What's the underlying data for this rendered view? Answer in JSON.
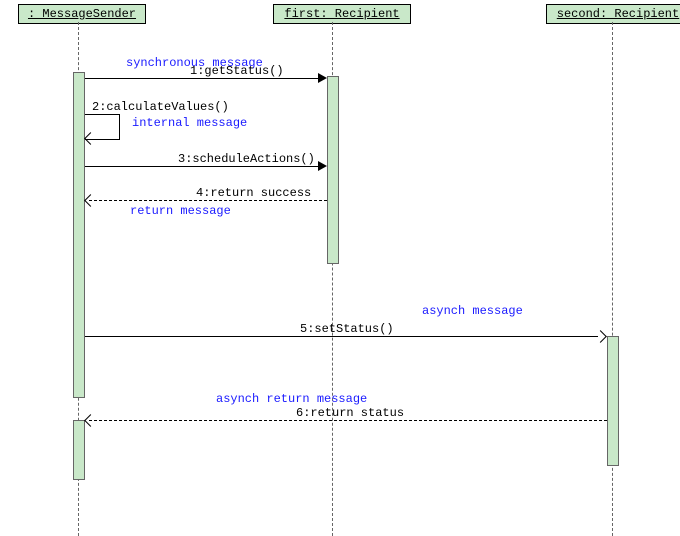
{
  "participants": {
    "p1": ": MessageSender",
    "p2": "first: Recipient",
    "p3": "second: Recipient"
  },
  "messages": {
    "m1": "1:getStatus()",
    "m2": "2:calculateValues()",
    "m3": "3:scheduleActions()",
    "m4": "4:return success",
    "m5": "5:setStatus()",
    "m6": "6:return status"
  },
  "annotations": {
    "sync": "synchronous message",
    "internal": "internal message",
    "ret": "return message",
    "asynch": "asynch message",
    "asynch_ret": "asynch return message"
  },
  "colors": {
    "participant_bg": "#c9e8c9",
    "annotation": "#1a1aff"
  },
  "chart_data": {
    "type": "sequence-diagram",
    "participants": [
      {
        "id": "sender",
        "label": ": MessageSender"
      },
      {
        "id": "first",
        "label": "first: Recipient"
      },
      {
        "id": "second",
        "label": "second: Recipient"
      }
    ],
    "messages": [
      {
        "seq": 1,
        "from": "sender",
        "to": "first",
        "label": "getStatus()",
        "kind": "sync",
        "note": "synchronous message"
      },
      {
        "seq": 2,
        "from": "sender",
        "to": "sender",
        "label": "calculateValues()",
        "kind": "self",
        "note": "internal message"
      },
      {
        "seq": 3,
        "from": "sender",
        "to": "first",
        "label": "scheduleActions()",
        "kind": "sync"
      },
      {
        "seq": 4,
        "from": "first",
        "to": "sender",
        "label": "return success",
        "kind": "return",
        "note": "return message"
      },
      {
        "seq": 5,
        "from": "sender",
        "to": "second",
        "label": "setStatus()",
        "kind": "async",
        "note": "asynch message"
      },
      {
        "seq": 6,
        "from": "second",
        "to": "sender",
        "label": "return status",
        "kind": "async-return",
        "note": "asynch return message"
      }
    ]
  }
}
